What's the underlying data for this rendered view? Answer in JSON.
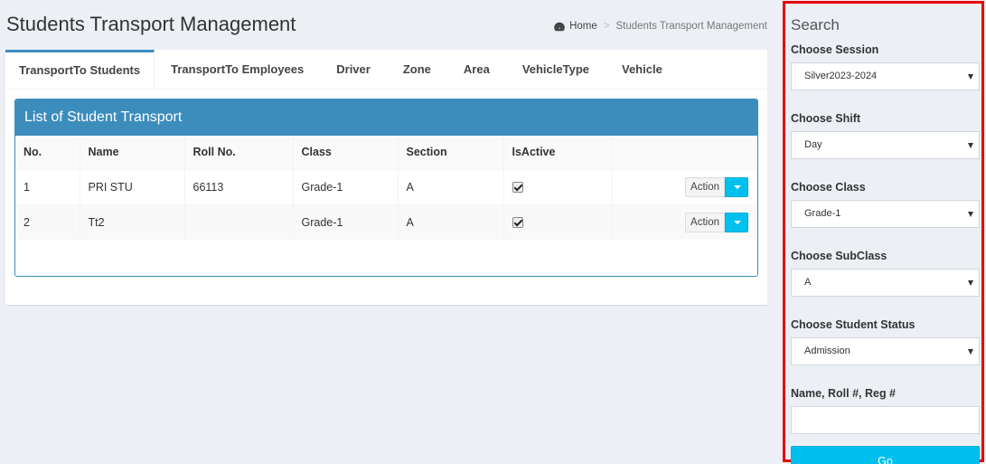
{
  "page": {
    "title": "Students Transport Management",
    "breadcrumb": {
      "home": "Home",
      "current": "Students Transport Management"
    }
  },
  "tabs": [
    {
      "label": "TransportTo Students",
      "active": true
    },
    {
      "label": "TransportTo Employees"
    },
    {
      "label": "Driver"
    },
    {
      "label": "Zone"
    },
    {
      "label": "Area"
    },
    {
      "label": "VehicleType"
    },
    {
      "label": "Vehicle"
    }
  ],
  "panel": {
    "title": "List of Student Transport",
    "columns": [
      "No.",
      "Name",
      "Roll No.",
      "Class",
      "Section",
      "IsActive",
      ""
    ],
    "rows": [
      {
        "no": "1",
        "name": "PRI STU",
        "roll": "66113",
        "class": "Grade-1",
        "section": "A",
        "active": true,
        "action": "Action"
      },
      {
        "no": "2",
        "name": "Tt2",
        "roll": "",
        "class": "Grade-1",
        "section": "A",
        "active": true,
        "action": "Action"
      }
    ]
  },
  "search": {
    "title": "Search",
    "session_label": "Choose Session",
    "session_value": "Silver2023-2024",
    "shift_label": "Choose Shift",
    "shift_value": "Day",
    "class_label": "Choose Class",
    "class_value": "Grade-1",
    "subclass_label": "Choose SubClass",
    "subclass_value": "A",
    "status_label": "Choose Student Status",
    "status_value": "Admission",
    "query_label": "Name, Roll #, Reg #",
    "query_value": "",
    "go_label": "Go"
  },
  "colors": {
    "primary": "#3c8dbc",
    "info": "#00c0ef",
    "highlight": "#e60000",
    "background": "#ecf0f5"
  }
}
